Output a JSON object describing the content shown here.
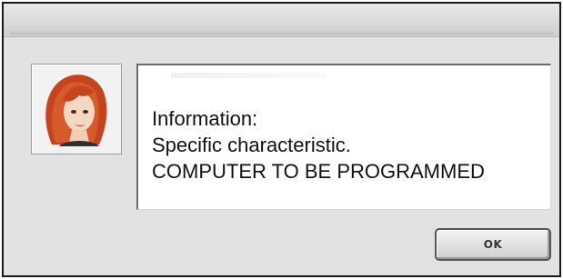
{
  "dialog": {
    "message_lines": [
      "Information:",
      "Specific characteristic.",
      "COMPUTER TO BE PROGRAMMED"
    ],
    "ok_label": "OK"
  },
  "icons": {
    "avatar": "woman-portrait-icon"
  },
  "colors": {
    "window_bg": "#e2e2e2",
    "border": "#1a1a1a",
    "message_bg": "#ffffff",
    "hair": "#c5431d"
  }
}
